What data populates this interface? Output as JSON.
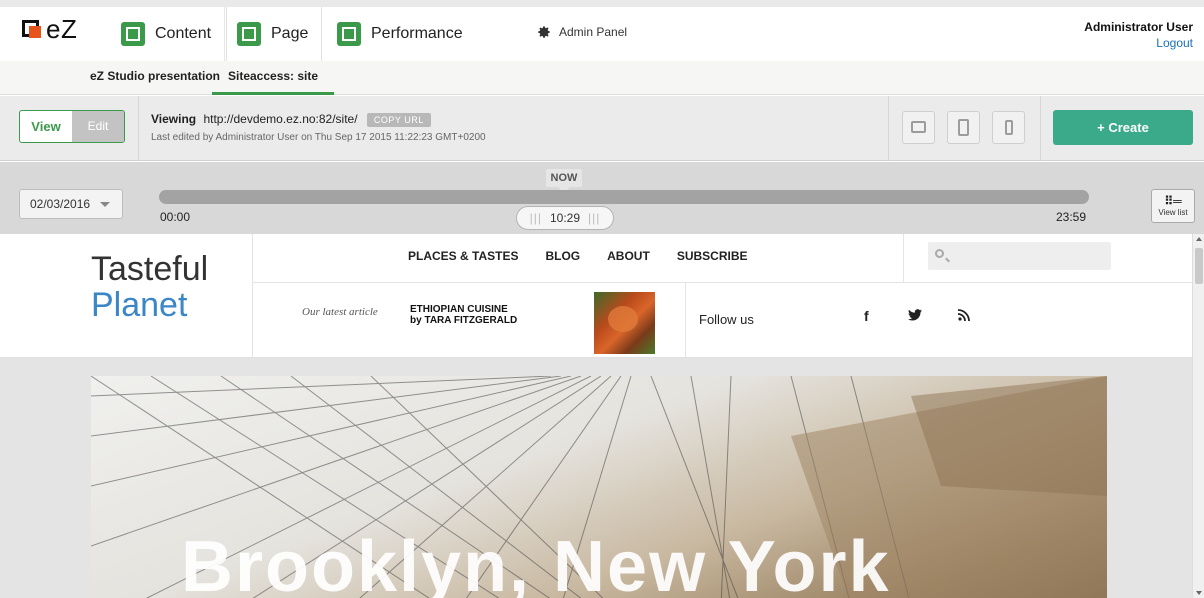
{
  "app": {
    "logo_text": "eZ",
    "tabs": [
      {
        "label": "Content"
      },
      {
        "label": "Page"
      },
      {
        "label": "Performance"
      }
    ],
    "admin_panel": "Admin Panel",
    "user": {
      "name": "Administrator User",
      "logout": "Logout"
    }
  },
  "subnav": {
    "items": [
      {
        "label": "eZ Studio presentation"
      },
      {
        "label": "Siteaccess: site"
      }
    ]
  },
  "toolbar": {
    "view_label": "View",
    "edit_label": "Edit",
    "viewing_label": "Viewing",
    "viewing_url": "http://devdemo.ez.no:82/site/",
    "copy_url_label": "COPY URL",
    "last_edited": "Last edited by Administrator User on Thu Sep 17 2015 11:22:23 GMT+0200",
    "create_label": "+ Create",
    "devices": [
      "desktop-icon",
      "tablet-icon",
      "mobile-icon"
    ]
  },
  "timeline": {
    "date": "02/03/2016",
    "now_label": "NOW",
    "start_time": "00:00",
    "end_time": "23:59",
    "current_time": "10:29",
    "view_list_label": "View list"
  },
  "site": {
    "brand_line1": "Tasteful",
    "brand_line2": "Planet",
    "menu": [
      "PLACES & TASTES",
      "BLOG",
      "ABOUT",
      "SUBSCRIBE"
    ],
    "latest_label": "Our latest article",
    "article_title_line1": "ETHIOPIAN CUISINE",
    "article_title_line2": "by TARA FITZGERALD",
    "follow_label": "Follow us",
    "social": {
      "facebook": "f",
      "twitter": "🐦",
      "rss": "⟟"
    },
    "hero_title": "Brooklyn, New York"
  },
  "colors": {
    "accent_green": "#3a9a4a",
    "create_button": "#3aaa8a",
    "brand_blue": "#3a86c7",
    "logo_orange": "#e8531c"
  }
}
